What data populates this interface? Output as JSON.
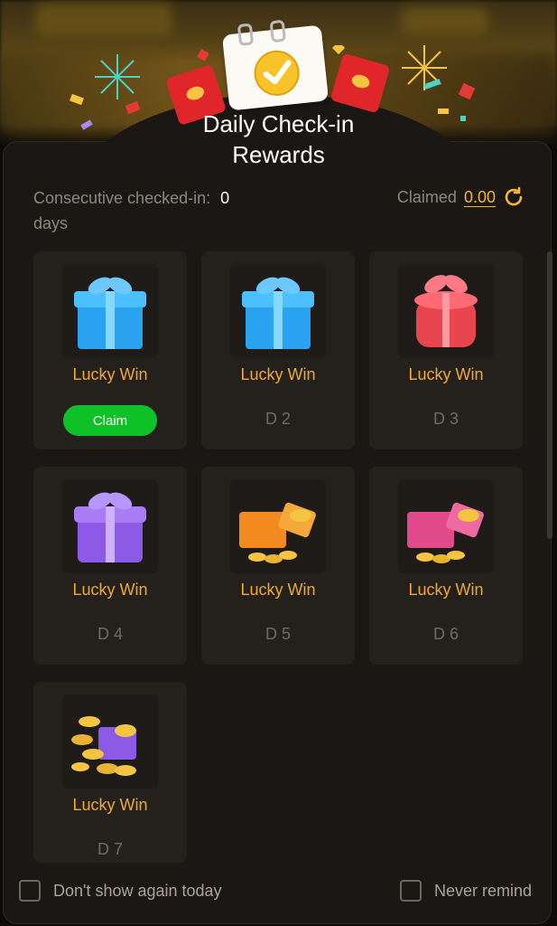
{
  "modal": {
    "title": "Daily Check-in\nRewards"
  },
  "stats": {
    "consecutive_label": "Consecutive checked-in:",
    "consecutive_value": "0",
    "days_label": "days",
    "claimed_label": "Claimed",
    "claimed_value": "0.00"
  },
  "rewards": [
    {
      "label": "Lucky Win",
      "day": "",
      "claim_label": "Claim",
      "icon": "blue-gift-icon"
    },
    {
      "label": "Lucky Win",
      "day": "D 2",
      "icon": "blue-gift-icon"
    },
    {
      "label": "Lucky Win",
      "day": "D 3",
      "icon": "red-gift-box-icon"
    },
    {
      "label": "Lucky Win",
      "day": "D 4",
      "icon": "purple-gift-icon"
    },
    {
      "label": "Lucky Win",
      "day": "D 5",
      "icon": "orange-gift-coins-icon"
    },
    {
      "label": "Lucky Win",
      "day": "D 6",
      "icon": "pink-gift-coins-icon"
    },
    {
      "label": "Lucky Win",
      "day": "D 7",
      "icon": "gold-coins-gift-icon"
    }
  ],
  "footer": {
    "dont_show_label": "Don't show again today",
    "never_remind_label": "Never remind"
  },
  "colors": {
    "accent": "#f0a92e",
    "claim_button": "#0ec127",
    "panel": "#1a1714",
    "card": "#24211d"
  }
}
